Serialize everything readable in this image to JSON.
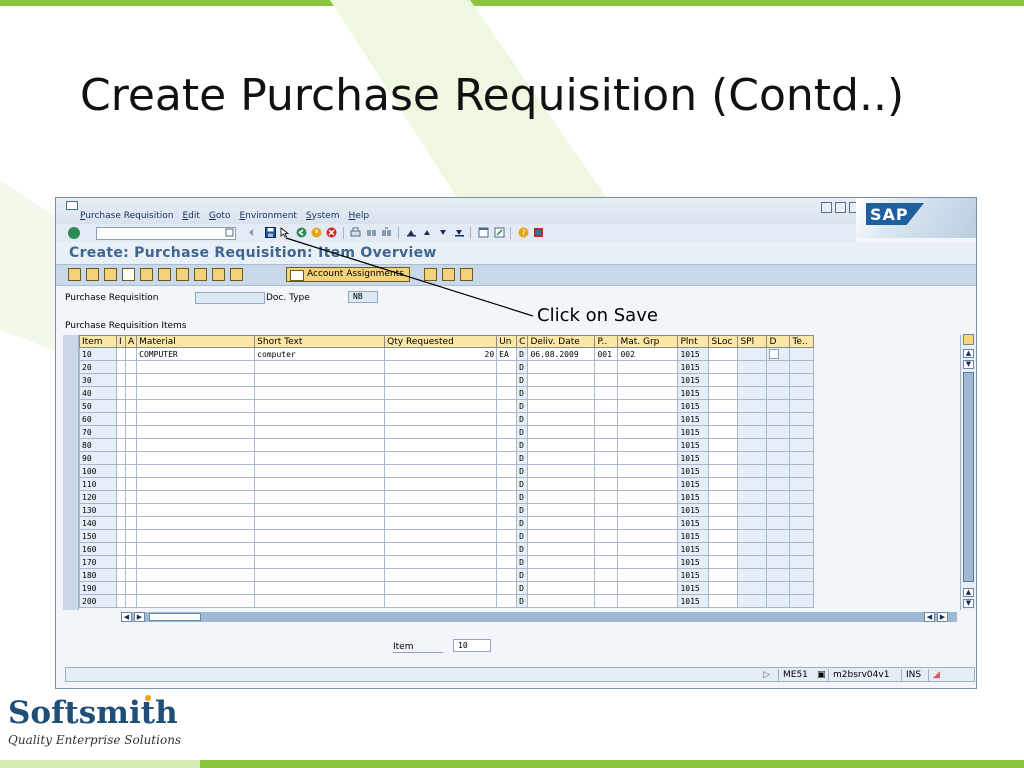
{
  "slide": {
    "title": "Create Purchase Requisition (Contd..)",
    "callout": "Click on Save",
    "accent_green": "#8cc63f"
  },
  "sap": {
    "menu": [
      "Purchase Requisition",
      "Edit",
      "Goto",
      "Environment",
      "System",
      "Help"
    ],
    "logo_text": "SAP",
    "screen_title": "Create: Purchase Requisition: Item Overview",
    "account_assignments_label": "Account Assignments",
    "purchase_requisition_label": "Purchase Requisition",
    "purchase_requisition_value": "",
    "doc_type_label": "Doc. Type",
    "doc_type_value": "NB",
    "section_title": "Purchase Requisition Items",
    "columns": [
      "Item",
      "I",
      "A",
      "Material",
      "Short Text",
      "Qty Requested",
      "Un",
      "C",
      "Deliv. Date",
      "P..",
      "Mat. Grp",
      "Plnt",
      "SLoc",
      "SPl",
      "D",
      "Te.."
    ],
    "rows": [
      {
        "item": "10",
        "i": "",
        "a": "",
        "material": "COMPUTER",
        "short_text": "computer",
        "qty": "20",
        "un": "EA",
        "c": "D",
        "deliv_date": "06.08.2009",
        "p": "001",
        "mat_grp": "002",
        "plnt": "1015",
        "sloc": "",
        "spl": "",
        "d": "checkbox",
        "te": ""
      },
      {
        "item": "20",
        "c": "D",
        "plnt": "1015"
      },
      {
        "item": "30",
        "c": "D",
        "plnt": "1015"
      },
      {
        "item": "40",
        "c": "D",
        "plnt": "1015"
      },
      {
        "item": "50",
        "c": "D",
        "plnt": "1015"
      },
      {
        "item": "60",
        "c": "D",
        "plnt": "1015"
      },
      {
        "item": "70",
        "c": "D",
        "plnt": "1015"
      },
      {
        "item": "80",
        "c": "D",
        "plnt": "1015"
      },
      {
        "item": "90",
        "c": "D",
        "plnt": "1015"
      },
      {
        "item": "100",
        "c": "D",
        "plnt": "1015"
      },
      {
        "item": "110",
        "c": "D",
        "plnt": "1015"
      },
      {
        "item": "120",
        "c": "D",
        "plnt": "1015"
      },
      {
        "item": "130",
        "c": "D",
        "plnt": "1015"
      },
      {
        "item": "140",
        "c": "D",
        "plnt": "1015"
      },
      {
        "item": "150",
        "c": "D",
        "plnt": "1015"
      },
      {
        "item": "160",
        "c": "D",
        "plnt": "1015"
      },
      {
        "item": "170",
        "c": "D",
        "plnt": "1015"
      },
      {
        "item": "180",
        "c": "D",
        "plnt": "1015"
      },
      {
        "item": "190",
        "c": "D",
        "plnt": "1015"
      },
      {
        "item": "200",
        "c": "D",
        "plnt": "1015"
      }
    ],
    "item_label": "Item",
    "item_value": "10",
    "status": {
      "transaction": "ME51",
      "server": "m2bsrv04v1",
      "mode": "INS"
    }
  },
  "brand": {
    "name": "Softsmith",
    "tagline": "Quality Enterprise Solutions"
  }
}
